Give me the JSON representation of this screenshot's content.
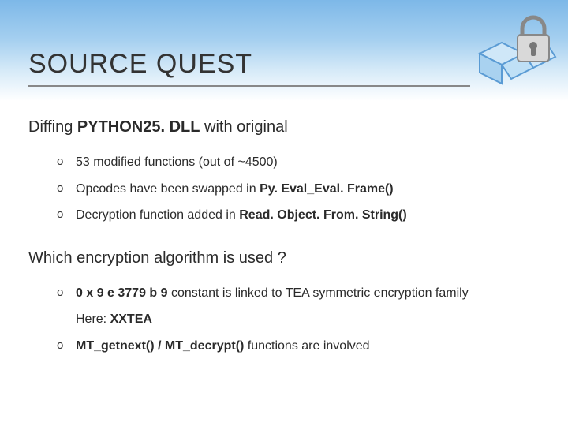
{
  "title": "SOURCE QUEST",
  "section1": {
    "heading_pre": "Diffing ",
    "heading_bold": "PYTHON25. DLL",
    "heading_post": " with original",
    "items": [
      {
        "pre": "53 modified functions (out of ~4500)",
        "bold": "",
        "post": ""
      },
      {
        "pre": "Opcodes have been swapped in ",
        "bold": "Py. Eval_Eval. Frame()",
        "post": ""
      },
      {
        "pre": "Decryption function added in ",
        "bold": "Read. Object. From. String()",
        "post": ""
      }
    ]
  },
  "section2": {
    "heading": "Which encryption algorithm is used ?",
    "items": [
      {
        "pre": "",
        "bold": "0 x 9 e 3779 b 9",
        "post": " constant is linked to TEA symmetric encryption family",
        "marker": true
      },
      {
        "pre": "Here: ",
        "bold": "XXTEA",
        "post": "",
        "marker": false
      },
      {
        "pre": "",
        "bold": "MT_getnext() / MT_decrypt()",
        "post": " functions are involved",
        "marker": true
      }
    ]
  }
}
